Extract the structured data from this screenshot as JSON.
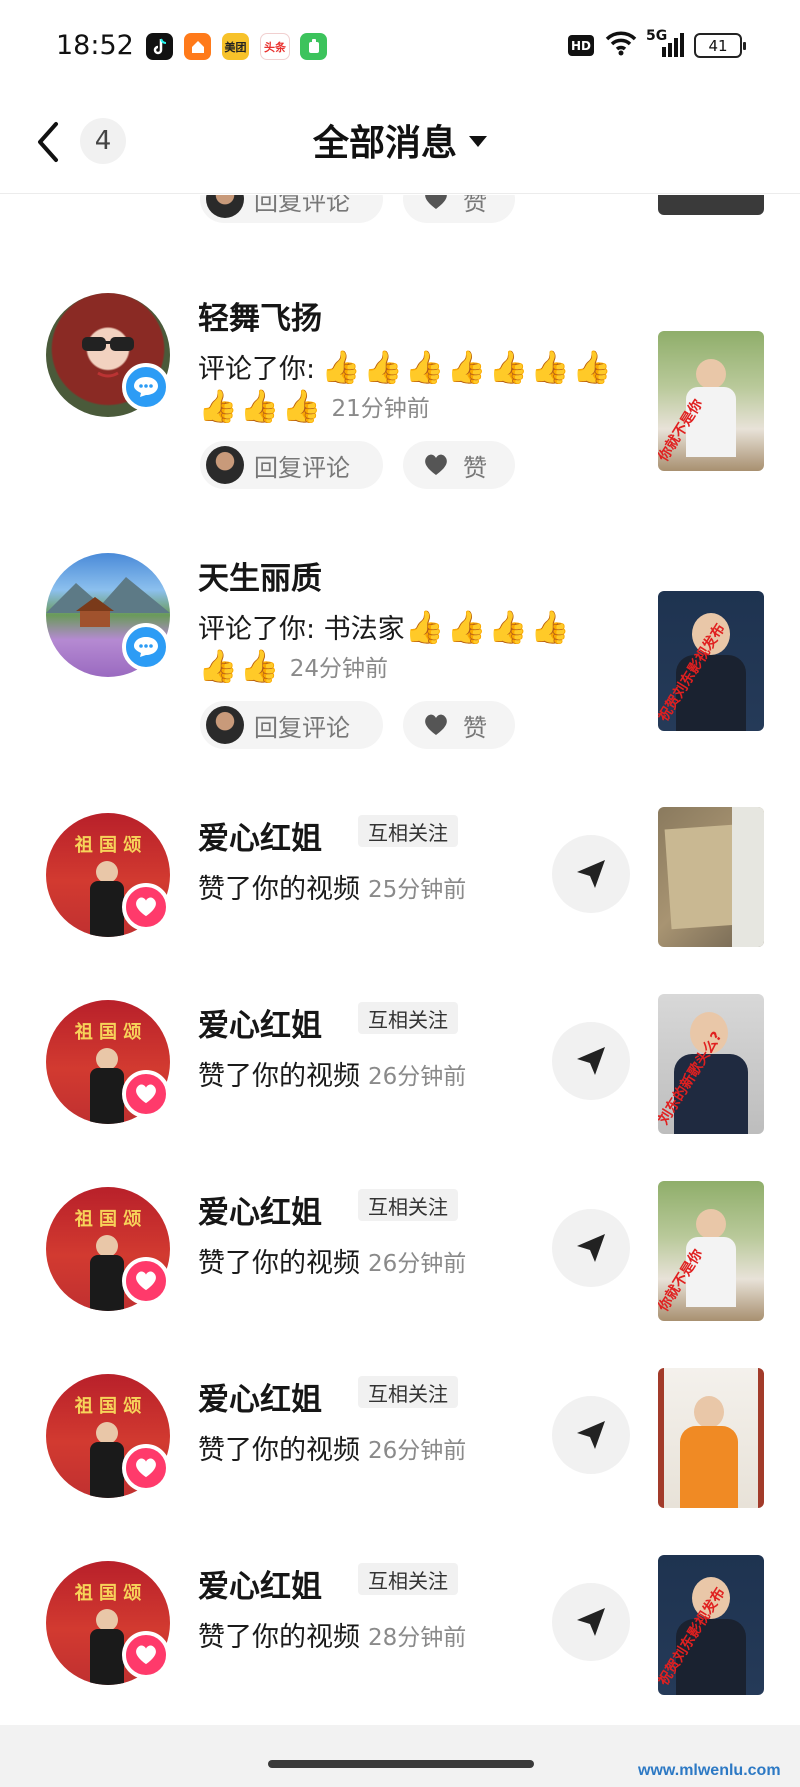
{
  "status_bar": {
    "time": "18:52",
    "apps": [
      {
        "name": "douyin-app-icon",
        "label": "",
        "color": "#111111"
      },
      {
        "name": "home-app-icon",
        "label": "",
        "color": "#ff7a1a"
      },
      {
        "name": "meituan-app-icon",
        "label": "美团",
        "color": "#f7c22a"
      },
      {
        "name": "toutiao-app-icon",
        "label": "头条",
        "color": "#e8322f"
      },
      {
        "name": "green-app-icon",
        "label": "",
        "color": "#3cc35c"
      }
    ],
    "hd": "HD",
    "network": "5G",
    "battery": "41"
  },
  "header": {
    "unread_count": "4",
    "title": "全部消息"
  },
  "actions": {
    "reply": "回复评论",
    "like": "赞"
  },
  "messages": [
    {
      "name": "轻舞飞扬",
      "text": "评论了你:",
      "emoji_count_line1": 7,
      "emoji_count_line2": 3,
      "time": "21分钟前",
      "thumb_caption": "你就不是你"
    },
    {
      "name": "天生丽质",
      "text": "评论了你: 书法家",
      "emoji_count_line1": 4,
      "emoji_count_line2": 2,
      "time": "24分钟前",
      "thumb_caption": "祝贺刘东影视发布"
    },
    {
      "name": "爱心红姐",
      "tag": "互相关注",
      "text": "赞了你的视频",
      "time": "25分钟前",
      "thumb_caption": ""
    },
    {
      "name": "爱心红姐",
      "tag": "互相关注",
      "text": "赞了你的视频",
      "time": "26分钟前",
      "thumb_caption": "刘东的新歌头么?"
    },
    {
      "name": "爱心红姐",
      "tag": "互相关注",
      "text": "赞了你的视频",
      "time": "26分钟前",
      "thumb_caption": "你就不是你"
    },
    {
      "name": "爱心红姐",
      "tag": "互相关注",
      "text": "赞了你的视频",
      "time": "26分钟前",
      "thumb_caption": ""
    },
    {
      "name": "爱心红姐",
      "tag": "互相关注",
      "text": "赞了你的视频",
      "time": "28分钟前",
      "thumb_caption": "祝贺刘东影视发布"
    }
  ],
  "avatar_banner": "祖 国 颂",
  "watermark": "www.mlwenlu.com",
  "colors": {
    "comment_badge": "#2c9cf5",
    "like_badge": "#ff3a6b",
    "time_gray": "#8a8a8a"
  }
}
